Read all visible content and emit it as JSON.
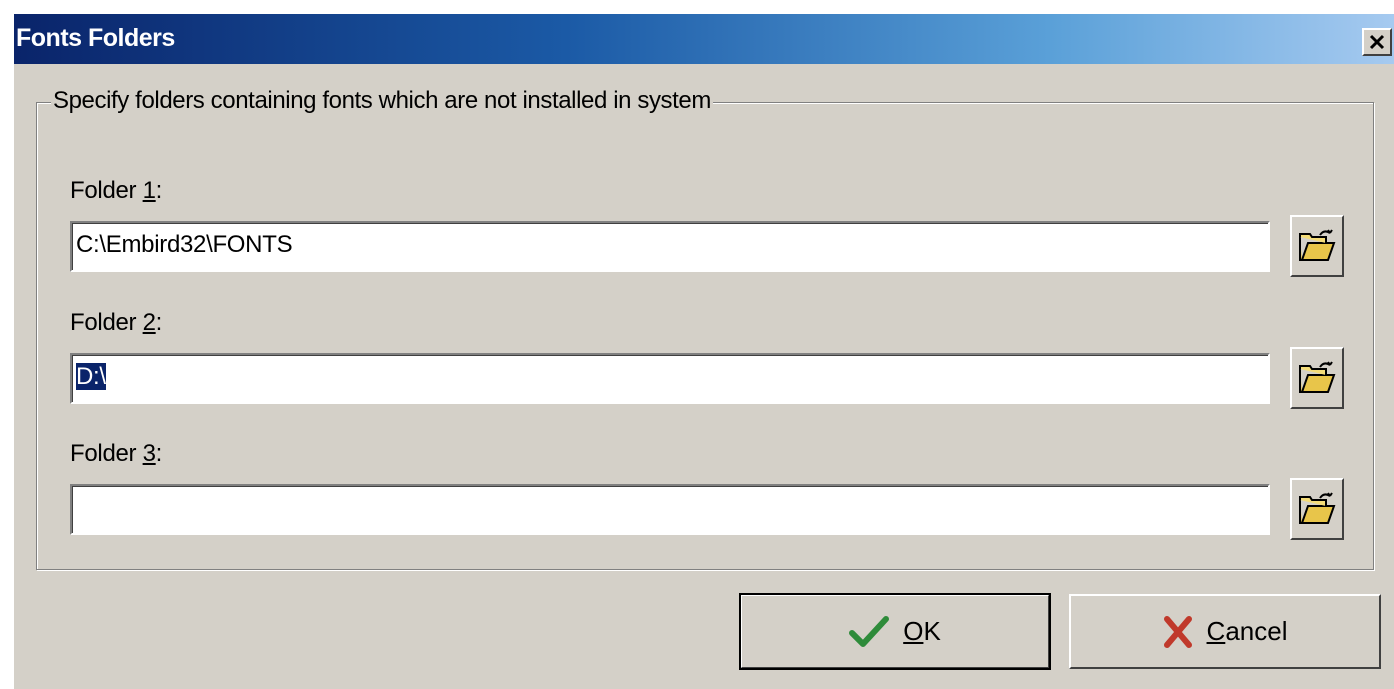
{
  "window": {
    "title": "Fonts Folders",
    "close_label": "X"
  },
  "group": {
    "title": "Specify folders containing fonts which are not installed in system"
  },
  "folders": [
    {
      "label_prefix": "Folder ",
      "label_key": "1",
      "label_suffix": ":",
      "value": "C:\\Embird32\\FONTS"
    },
    {
      "label_prefix": "Folder ",
      "label_key": "2",
      "label_suffix": ":",
      "value": "D:\\"
    },
    {
      "label_prefix": "Folder ",
      "label_key": "3",
      "label_suffix": ":",
      "value": ""
    }
  ],
  "buttons": {
    "ok_key": "O",
    "ok_rest": "K",
    "cancel_key": "C",
    "cancel_rest": "ancel"
  },
  "icons": {
    "ok": "checkmark-icon",
    "cancel": "x-mark-icon",
    "browse": "open-folder-icon",
    "close": "close-icon"
  },
  "colors": {
    "title_start": "#0a246a",
    "title_end": "#a6caf0",
    "ok_check": "#2e8b3a",
    "cancel_x": "#c0392b",
    "folder_yellow": "#e8c54a"
  }
}
